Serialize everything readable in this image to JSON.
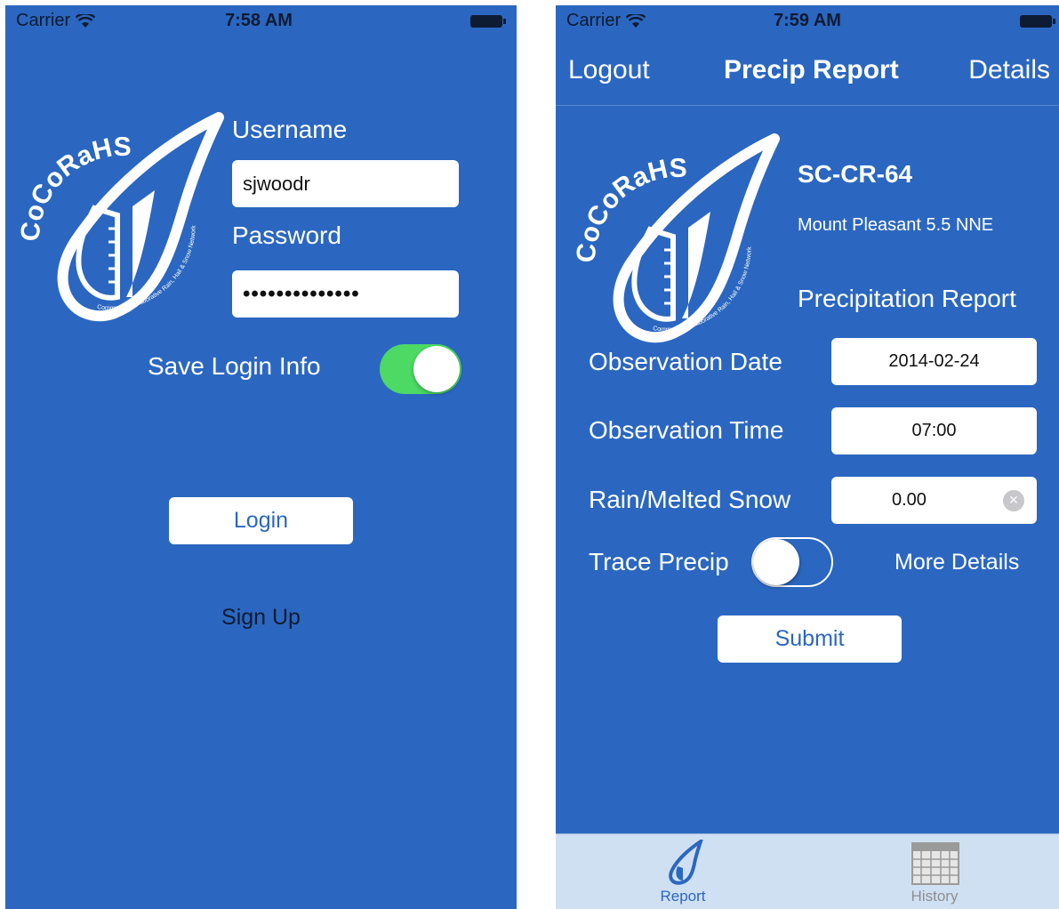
{
  "login_screen": {
    "status": {
      "carrier": "Carrier",
      "time": "7:58 AM"
    },
    "logo": {
      "text": "CoCoRaHS",
      "tagline": "Community Collaborative Rain, Hail & Snow Network"
    },
    "username_label": "Username",
    "username_value": "sjwoodr",
    "password_label": "Password",
    "password_value": "••••••••••••••",
    "save_login_label": "Save Login Info",
    "save_login_on": true,
    "login_button": "Login",
    "signup_link": "Sign Up"
  },
  "report_screen": {
    "status": {
      "carrier": "Carrier",
      "time": "7:59 AM"
    },
    "nav": {
      "left": "Logout",
      "title": "Precip Report",
      "right": "Details"
    },
    "logo": {
      "text": "CoCoRaHS",
      "tagline": "Community Collaborative Rain, Hail & Snow Network"
    },
    "station_id": "SC-CR-64",
    "station_name": "Mount Pleasant 5.5 NNE",
    "section_title": "Precipitation Report",
    "fields": {
      "date_label": "Observation Date",
      "date_value": "2014-02-24",
      "time_label": "Observation Time",
      "time_value": "07:00",
      "rain_label": "Rain/Melted Snow",
      "rain_value": "0.00"
    },
    "trace_label": "Trace Precip",
    "trace_on": false,
    "more_details": "More Details",
    "submit_button": "Submit",
    "tabs": [
      {
        "label": "Report",
        "icon": "raindrop-gauge-icon"
      },
      {
        "label": "History",
        "icon": "calendar-icon"
      }
    ]
  },
  "colors": {
    "background": "#2b67c0",
    "toggle_on": "#4cd964",
    "tabbar": "#cfe0f3"
  }
}
